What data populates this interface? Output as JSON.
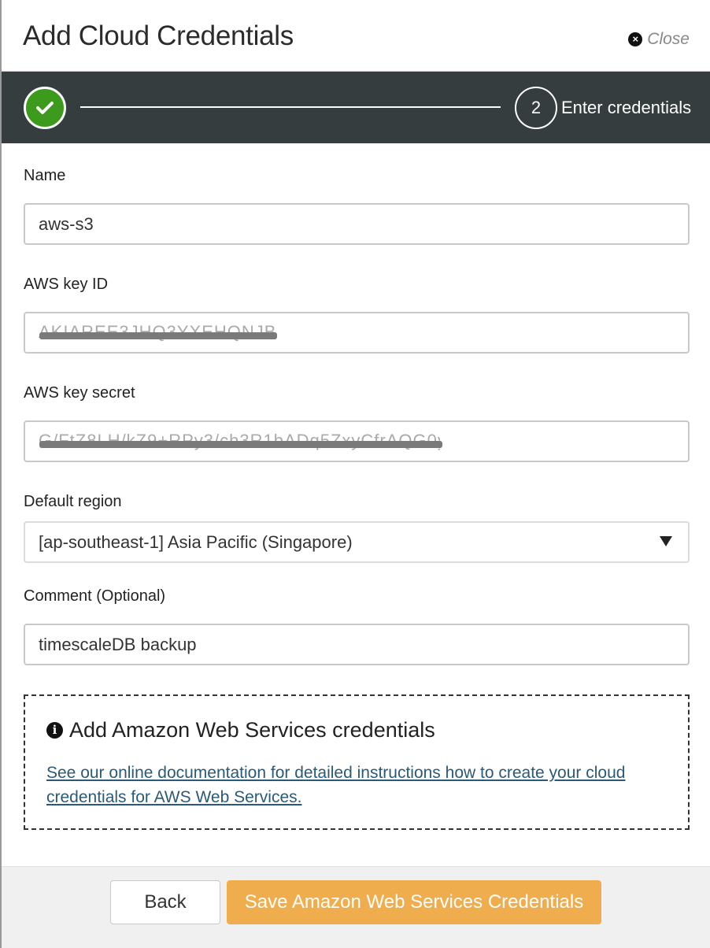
{
  "dialog": {
    "title": "Add Cloud Credentials",
    "close_label": "Close"
  },
  "stepper": {
    "step2_number": "2",
    "step2_label": "Enter credentials"
  },
  "form": {
    "name_label": "Name",
    "name_value": "aws-s3",
    "key_id_label": "AWS key ID",
    "key_id_value": "AKIAREE3JHQ3YXEHQNJB",
    "key_secret_label": "AWS key secret",
    "key_secret_value": "G/FtZ8LH/kZ9+RPy3/ch3R1bADq5ZxyCfrAQG0y",
    "region_label": "Default region",
    "region_value": "[ap-southeast-1] Asia Pacific (Singapore)",
    "comment_label": "Comment (Optional)",
    "comment_value": "timescaleDB backup"
  },
  "info": {
    "title": "Add Amazon Web Services credentials",
    "link_text": "See our online documentation for detailed instructions how to create your cloud credentials for AWS Web Services."
  },
  "footer": {
    "back_label": "Back",
    "save_label": "Save Amazon Web Services Credentials"
  },
  "colors": {
    "stepper_bg": "#363d3e",
    "success_green": "#3c9a1c",
    "save_orange": "#f0ad4e",
    "link_blue": "#2a5a7a"
  }
}
